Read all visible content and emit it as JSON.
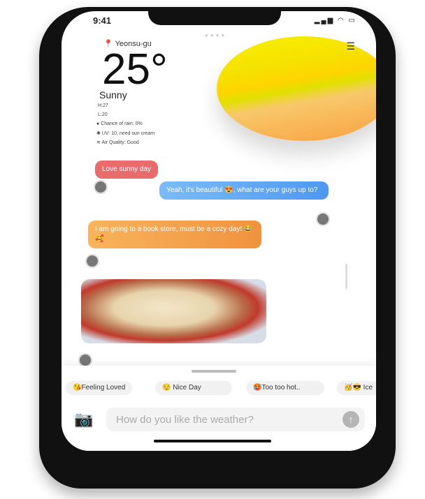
{
  "status": {
    "time": "9:41"
  },
  "weather": {
    "location": "Yeonsu-gu",
    "temperature": "25°",
    "condition": "Sunny",
    "high": "H:27",
    "low": "L:20",
    "rain": "Chance of rain: 0%",
    "uv": "UV: 10, need sun cream",
    "air": "Air Quality: Good"
  },
  "messages": [
    {
      "text": "Love sunny day",
      "color": "#e96b6b"
    },
    {
      "text": "Yeah, it's beautiful 😍, what are your guys up to?",
      "color": "#5fa8f5"
    },
    {
      "text": "I am going to a book store, must be a cozy day! 😂🥰",
      "color": "#f5a14a"
    }
  ],
  "chips": [
    "😘Feeling Loved",
    "😌 Nice Day",
    "🥵Too too hot..",
    "🥳😎 Ice"
  ],
  "composer": {
    "placeholder": "How do you like the weather?"
  }
}
